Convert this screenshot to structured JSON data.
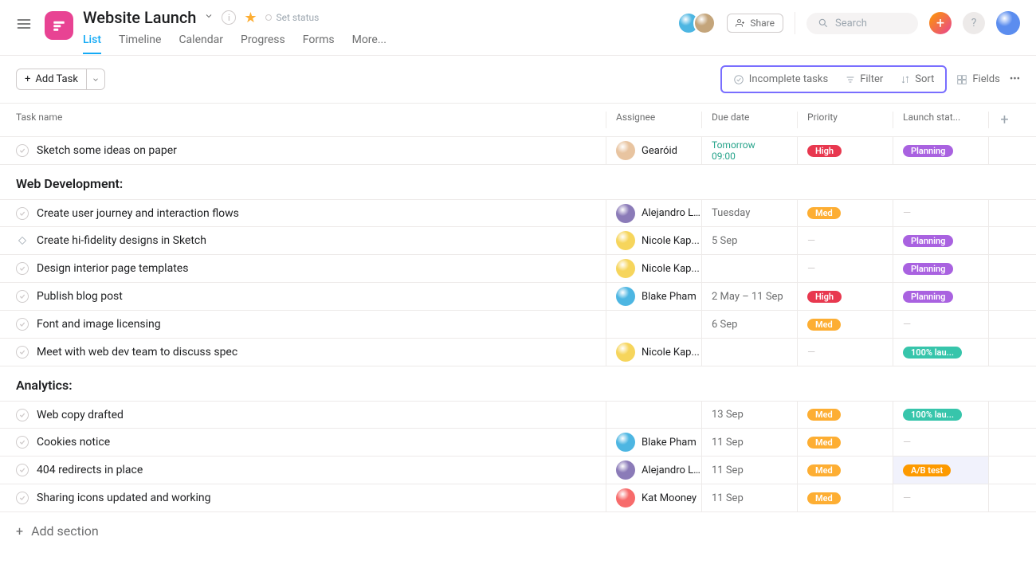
{
  "header": {
    "project_title": "Website Launch",
    "set_status": "Set status",
    "share_label": "Share",
    "search_placeholder": "Search"
  },
  "tabs": [
    "List",
    "Timeline",
    "Calendar",
    "Progress",
    "Forms",
    "More..."
  ],
  "toolbar": {
    "add_task": "Add Task",
    "incomplete": "Incomplete tasks",
    "filter": "Filter",
    "sort": "Sort",
    "fields": "Fields"
  },
  "columns": {
    "task_name": "Task name",
    "assignee": "Assignee",
    "due_date": "Due date",
    "priority": "Priority",
    "launch_status": "Launch stat..."
  },
  "priority_labels": {
    "high": "High",
    "med": "Med"
  },
  "status_labels": {
    "planning": "Planning",
    "launch": "100% lau...",
    "abtest": "A/B test"
  },
  "assignees": {
    "gearoid": "Gearóid",
    "alejandro": "Alejandro L...",
    "nicole": "Nicole Kap...",
    "blake": "Blake Pham",
    "kat": "Kat Mooney"
  },
  "avatar_colors": {
    "gearoid": "#e8c4a0",
    "alejandro": "#8b7bb8",
    "nicole": "#f6d55c",
    "blake": "#4db6e2",
    "kat": "#f76b6b",
    "top1": "#4db6e2",
    "top2": "#c4a57b",
    "me": "#5b8def"
  },
  "ungrouped_task": {
    "name": "Sketch some ideas on paper",
    "due1": "Tomorrow",
    "due2": "09:00"
  },
  "sections": {
    "web_dev": {
      "title": "Web Development:",
      "tasks": [
        {
          "name": "Create user journey and interaction flows",
          "due": "Tuesday"
        },
        {
          "name": "Create hi-fidelity designs in Sketch",
          "due": "5 Sep"
        },
        {
          "name": "Design interior page templates",
          "due": ""
        },
        {
          "name": "Publish blog post",
          "due": "2 May – 11 Sep"
        },
        {
          "name": "Font and image licensing",
          "due": "6 Sep"
        },
        {
          "name": "Meet with web dev team to discuss spec",
          "due": ""
        }
      ]
    },
    "analytics": {
      "title": "Analytics:",
      "tasks": [
        {
          "name": "Web copy drafted",
          "due": "13 Sep"
        },
        {
          "name": "Cookies notice",
          "due": "11 Sep"
        },
        {
          "name": "404 redirects in place",
          "due": "11 Sep"
        },
        {
          "name": "Sharing icons updated and working",
          "due": "11 Sep"
        }
      ]
    }
  },
  "add_section_label": "Add section"
}
